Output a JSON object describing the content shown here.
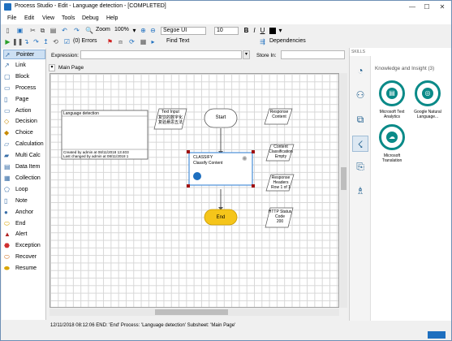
{
  "window": {
    "title": "Process Studio  - Edit - Language detection - [COMPLETED]",
    "minimize": "—",
    "maximize": "☐",
    "close": "✕"
  },
  "menu": [
    "File",
    "Edit",
    "View",
    "Tools",
    "Debug",
    "Help"
  ],
  "toolbar1": {
    "zoom_label": "Zoom",
    "zoom_value": "100%",
    "font_name": "Segoe UI",
    "font_size": "10"
  },
  "toolbar2": {
    "errors_label": "(0) Errors",
    "find_text_label": "Find Text",
    "dependencies_label": "Dependencies"
  },
  "palette": [
    {
      "label": "Pointer",
      "icon": "pointer-icon"
    },
    {
      "label": "Link",
      "icon": "link-icon"
    },
    {
      "label": "Block",
      "icon": "block-icon"
    },
    {
      "label": "Process",
      "icon": "process-icon"
    },
    {
      "label": "Page",
      "icon": "page-icon"
    },
    {
      "label": "Action",
      "icon": "action-icon"
    },
    {
      "label": "Decision",
      "icon": "decision-icon"
    },
    {
      "label": "Choice",
      "icon": "choice-icon"
    },
    {
      "label": "Calculation",
      "icon": "calculation-icon"
    },
    {
      "label": "Multi Calc",
      "icon": "multi-calc-icon"
    },
    {
      "label": "Data Item",
      "icon": "data-item-icon"
    },
    {
      "label": "Collection",
      "icon": "collection-icon"
    },
    {
      "label": "Loop",
      "icon": "loop-icon"
    },
    {
      "label": "Note",
      "icon": "note-icon"
    },
    {
      "label": "Anchor",
      "icon": "anchor-icon"
    },
    {
      "label": "End",
      "icon": "end-icon"
    },
    {
      "label": "Alert",
      "icon": "alert-icon"
    },
    {
      "label": "Exception",
      "icon": "exception-icon"
    },
    {
      "label": "Recover",
      "icon": "recover-icon"
    },
    {
      "label": "Resume",
      "icon": "resume-icon"
    }
  ],
  "expression": {
    "label": "Expression:",
    "value": "",
    "store_label": "Store In:",
    "store_value": ""
  },
  "page_tab": "Main Page",
  "flow": {
    "info_box": {
      "title": "Language detection",
      "created": "Created  by  admin  at  08/11/2018 13:403",
      "changed": "Last  changed  by  admin  at  08/11/2018 1"
    },
    "text_input_label": "Text Input",
    "text_input_value": "复饮的数字化\n复验悬思五法",
    "start_label": "Start",
    "response_content": "Response\nContent",
    "classify_title": "CLASSIFY",
    "classify_sub": "Classify Content",
    "content_classification": "Content\nClassification\nEmpty",
    "response_headers": "Response\nHeaders\nRow 1 of 1",
    "http_status": "HTTP Status\nCode\n200",
    "end_label": "End"
  },
  "skills": {
    "header": "SKILLS",
    "title": "Knowledge and Insight (3)",
    "items": [
      {
        "label": "Microsoft Text\nAnalytics",
        "icon": "text-analytics-icon"
      },
      {
        "label": "Google Natural\nLanguage...",
        "icon": "google-nl-icon"
      },
      {
        "label": "Microsoft\nTranslation",
        "icon": "translation-icon"
      }
    ]
  },
  "status": "12/11/2018 08:12:06 END: 'End' Process: 'Language detection' Subsheet: 'Main Page'",
  "colors": {
    "accent": "#1e6fbf",
    "skill": "#0a8a88",
    "end_fill": "#f5c51a",
    "selection": "#4a90d9"
  }
}
